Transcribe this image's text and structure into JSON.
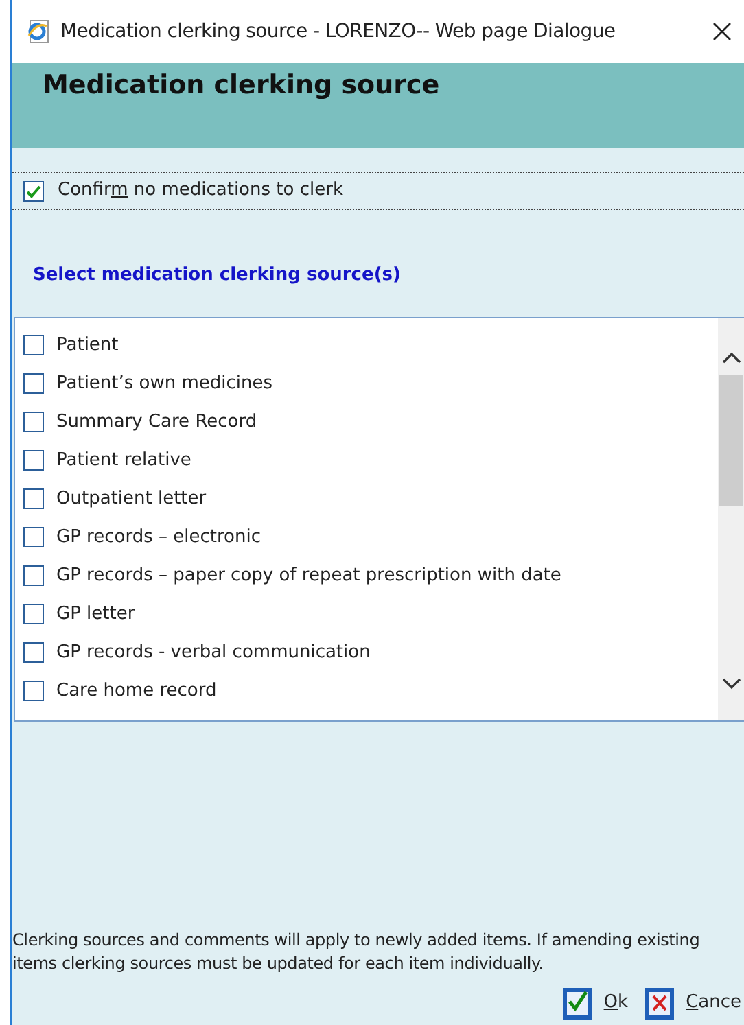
{
  "window": {
    "title": "Medication clerking source - LORENZO-- Web page Dialogue"
  },
  "header": {
    "title": "Medication clerking source"
  },
  "confirm": {
    "label": {
      "before": "Confir",
      "key": "m",
      "after": " no medications to clerk"
    },
    "checked": true
  },
  "section_heading": "Select medication clerking source(s)",
  "sources": [
    {
      "label": "Patient",
      "checked": false
    },
    {
      "label": "Patient’s own medicines",
      "checked": false
    },
    {
      "label": "Summary Care Record",
      "checked": false
    },
    {
      "label": "Patient relative",
      "checked": false
    },
    {
      "label": "Outpatient letter",
      "checked": false
    },
    {
      "label": "GP records – electronic",
      "checked": false
    },
    {
      "label": "GP records – paper copy of repeat prescription with date",
      "checked": false
    },
    {
      "label": "GP letter",
      "checked": false
    },
    {
      "label": "GP records - verbal communication",
      "checked": false
    },
    {
      "label": "Care home record",
      "checked": false
    }
  ],
  "note": "Clerking sources and comments will apply to newly added items. If amending existing items clerking sources must be updated for each item individually.",
  "buttons": [
    {
      "kind": "ok",
      "key": "O",
      "after": "k"
    },
    {
      "kind": "cancel",
      "key": "C",
      "after": "ance"
    }
  ]
}
